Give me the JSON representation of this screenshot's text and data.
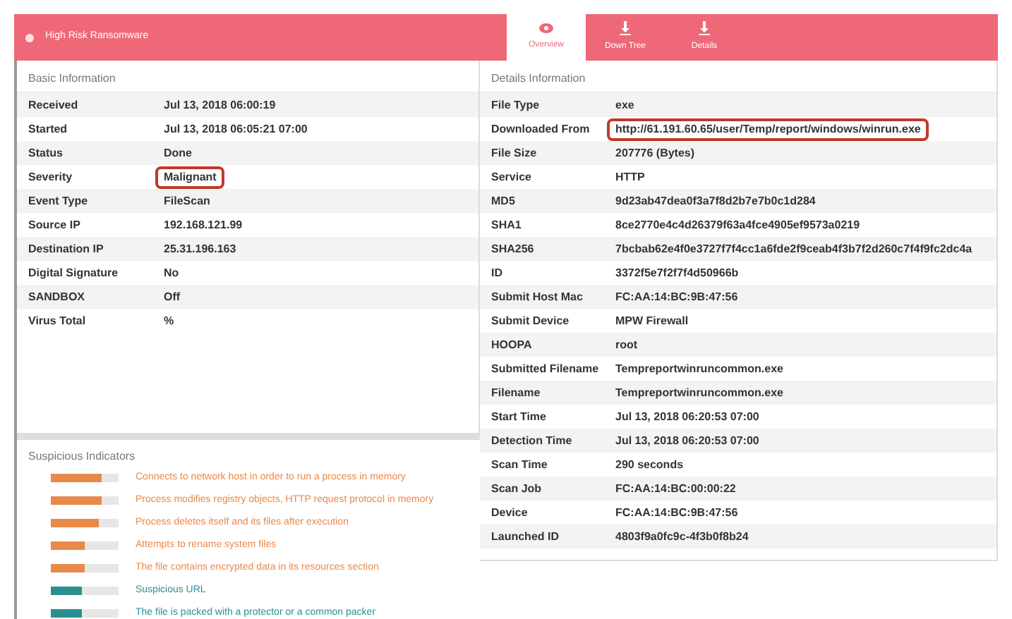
{
  "header": {
    "title": "High Risk Ransomware"
  },
  "tabs": [
    {
      "label": "Overview",
      "selected": true
    },
    {
      "label": "Down Tree",
      "selected": false
    },
    {
      "label": "Details",
      "selected": false
    }
  ],
  "basic_information": {
    "title": "Basic Information",
    "rows": [
      {
        "label": "Received",
        "value": "Jul 13, 2018 06:00:19",
        "highlighted": false
      },
      {
        "label": "Started",
        "value": "Jul 13, 2018 06:05:21 07:00",
        "highlighted": false
      },
      {
        "label": "Status",
        "value": "Done",
        "highlighted": false
      },
      {
        "label": "Severity",
        "value": "Malignant",
        "highlighted": true
      },
      {
        "label": "Event Type",
        "value": "FileScan",
        "highlighted": false
      },
      {
        "label": "Source IP",
        "value": "192.168.121.99",
        "highlighted": false
      },
      {
        "label": "Destination IP",
        "value": "25.31.196.163",
        "highlighted": false
      },
      {
        "label": "Digital Signature",
        "value": "No",
        "highlighted": false
      },
      {
        "label": "SANDBOX",
        "value": "Off",
        "highlighted": false
      },
      {
        "label": "Virus Total",
        "value": "%",
        "highlighted": false
      }
    ]
  },
  "suspicious_indicators": {
    "title": "Suspicious Indicators",
    "items": [
      {
        "level": 0.75,
        "color": "#e8894a",
        "text": "Connects to network host in order to run a process in memory"
      },
      {
        "level": 0.75,
        "color": "#e8894a",
        "text": "Process modifies registry objects, HTTP request protocol in memory"
      },
      {
        "level": 0.7,
        "color": "#e8894a",
        "text": "Process deletes itself and its files after execution"
      },
      {
        "level": 0.5,
        "color": "#e8894a",
        "text": "Attempts to rename system files"
      },
      {
        "level": 0.5,
        "color": "#e8894a",
        "text": "The file contains encrypted data in its resources section"
      },
      {
        "level": 0.45,
        "color": "#2a8f8f",
        "text": "Suspicious URL"
      },
      {
        "level": 0.45,
        "color": "#2a8f8f",
        "text": "The file is packed with a protector or a common packer"
      }
    ]
  },
  "details_information": {
    "title": "Details Information",
    "rows": [
      {
        "label": "File Type",
        "value": "exe",
        "highlighted": false
      },
      {
        "label": "Downloaded From",
        "value": "http://61.191.60.65/user/Temp/report/windows/winrun.exe",
        "highlighted": true
      },
      {
        "label": "File Size",
        "value": "207776 (Bytes)",
        "highlighted": false
      },
      {
        "label": "Service",
        "value": "HTTP",
        "highlighted": false
      },
      {
        "label": "MD5",
        "value": "9d23ab47dea0f3a7f8d2b7e7b0c1d284",
        "highlighted": false
      },
      {
        "label": "SHA1",
        "value": "8ce2770e4c4d26379f63a4fce4905ef9573a0219",
        "highlighted": false
      },
      {
        "label": "SHA256",
        "value": "7bcbab62e4f0e3727f7f4cc1a6fde2f9ceab4f3b7f2d260c7f4f9fc2dc4a",
        "highlighted": false
      },
      {
        "label": "ID",
        "value": "3372f5e7f2f7f4d50966b",
        "highlighted": false
      },
      {
        "label": "Submit Host Mac",
        "value": "FC:AA:14:BC:9B:47:56",
        "highlighted": false
      },
      {
        "label": "Submit Device",
        "value": "MPW Firewall",
        "highlighted": false
      },
      {
        "label": "HOOPA",
        "value": "root",
        "highlighted": false
      },
      {
        "label": "Submitted Filename",
        "value": "Tempreportwinruncommon.exe",
        "highlighted": false
      },
      {
        "label": "Filename",
        "value": "Tempreportwinruncommon.exe",
        "highlighted": false
      },
      {
        "label": "Start Time",
        "value": "Jul 13, 2018 06:20:53 07:00",
        "highlighted": false
      },
      {
        "label": "Detection Time",
        "value": "Jul 13, 2018 06:20:53 07:00",
        "highlighted": false
      },
      {
        "label": "Scan Time",
        "value": "290 seconds",
        "highlighted": false
      },
      {
        "label": "Scan Job",
        "value": "FC:AA:14:BC:00:00:22",
        "highlighted": false
      },
      {
        "label": "Device",
        "value": "FC:AA:14:BC:9B:47:56",
        "highlighted": false
      },
      {
        "label": "Launched ID",
        "value": "4803f9a0fc9c-4f3b0f8b24",
        "highlighted": false
      }
    ]
  }
}
